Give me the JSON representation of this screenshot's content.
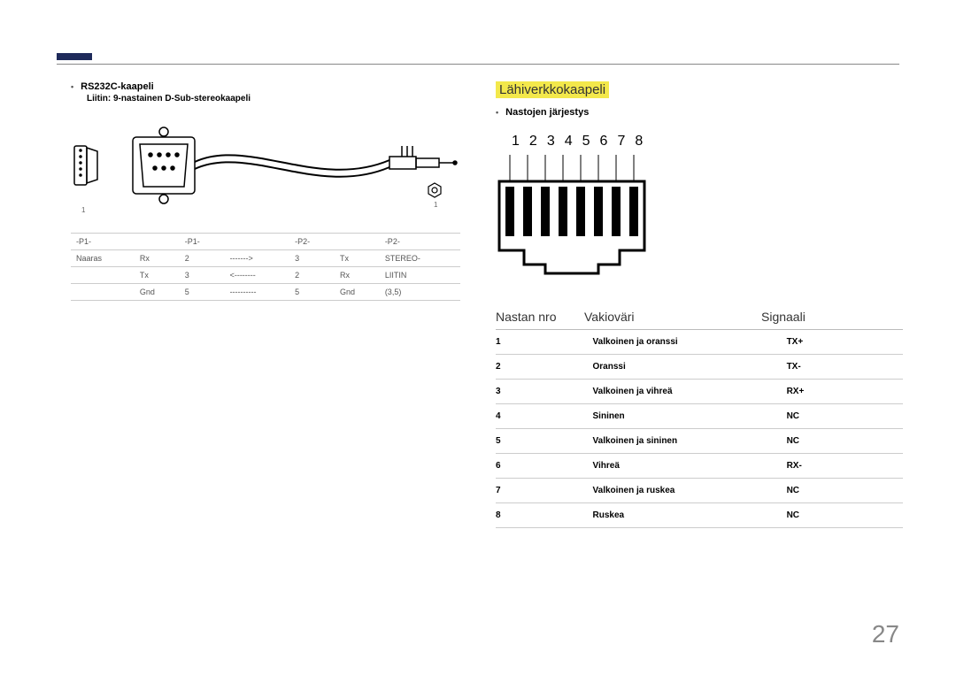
{
  "page_number": "27",
  "left": {
    "bullet": "•",
    "title": "RS232C-kaapeli",
    "subtitle": "Liitin: 9-nastainen D-Sub-stereokaapeli",
    "num1": "1",
    "num2": "1",
    "header": [
      "-P1-",
      "-P1-",
      "",
      "-P2-",
      "-P2-",
      ""
    ],
    "rows": [
      [
        "Naaras",
        "Rx",
        "2",
        "------->",
        "3",
        "Tx",
        "STEREO-"
      ],
      [
        "",
        "Tx",
        "3",
        "<--------",
        "2",
        "Rx",
        "LIITIN"
      ],
      [
        "",
        "Gnd",
        "5",
        "----------",
        "5",
        "Gnd",
        "(3,5)"
      ]
    ]
  },
  "right": {
    "heading": "Lähiverkkokaapeli",
    "bullet": "•",
    "pinorder": "Nastojen järjestys",
    "pins": [
      "1",
      "2",
      "3",
      "4",
      "5",
      "6",
      "7",
      "8"
    ],
    "table_head": [
      "Nastan nro",
      "Vakioväri",
      "Signaali"
    ],
    "rows": [
      [
        "1",
        "Valkoinen ja oranssi",
        "TX+"
      ],
      [
        "2",
        "Oranssi",
        "TX-"
      ],
      [
        "3",
        "Valkoinen ja vihreä",
        "RX+"
      ],
      [
        "4",
        "Sininen",
        "NC"
      ],
      [
        "5",
        "Valkoinen ja sininen",
        "NC"
      ],
      [
        "6",
        "Vihreä",
        "RX-"
      ],
      [
        "7",
        "Valkoinen ja ruskea",
        "NC"
      ],
      [
        "8",
        "Ruskea",
        "NC"
      ]
    ]
  }
}
